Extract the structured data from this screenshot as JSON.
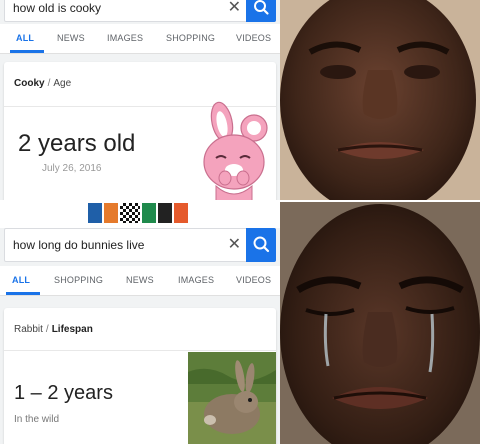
{
  "search1": {
    "query": "how old is cooky",
    "tabs": [
      "ALL",
      "NEWS",
      "IMAGES",
      "SHOPPING",
      "VIDEOS"
    ],
    "breadcrumb": [
      "Cooky",
      "Age"
    ],
    "answer": "2 years old",
    "date": "July 26, 2016",
    "image_subject": "Cooky pink bunny character"
  },
  "search2": {
    "query": "how long do bunnies live",
    "tabs": [
      "ALL",
      "SHOPPING",
      "NEWS",
      "IMAGES",
      "VIDEOS"
    ],
    "breadcrumb": [
      "Rabbit",
      "Lifespan"
    ],
    "answer": "1 – 2 years",
    "subtext": "In the wild",
    "image_subject": "wild rabbit"
  },
  "colors": {
    "accent": "#1a73e8",
    "bunny_pink": "#f4a3bd",
    "skin_dark": "#4a3025"
  },
  "icons": {
    "clear": "close-icon",
    "search": "search-icon"
  }
}
